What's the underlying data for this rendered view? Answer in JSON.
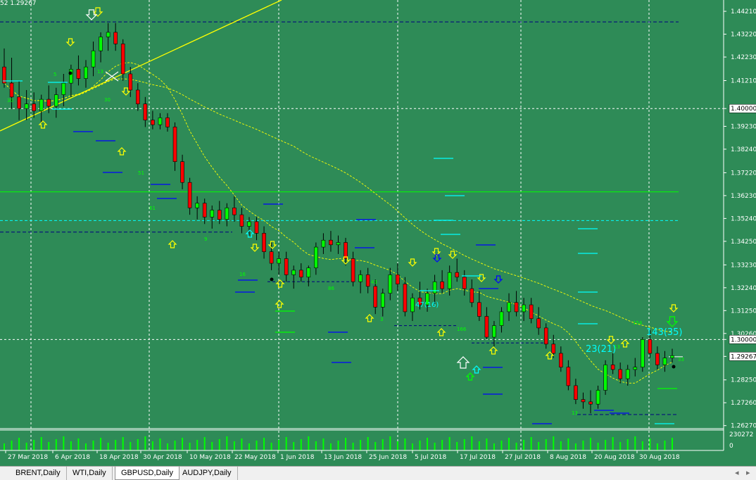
{
  "window": {
    "corner_text": "52 1.29267"
  },
  "price_axis": {
    "labels": [
      "1.44210",
      "1.43220",
      "1.42230",
      "1.41210",
      "1.40000",
      "1.39230",
      "1.38240",
      "1.37220",
      "1.36230",
      "1.35240",
      "1.34250",
      "1.33230",
      "1.32240",
      "1.31250",
      "1.30260",
      "1.30000",
      "1.29267",
      "1.28250",
      "1.27260",
      "1.26270"
    ],
    "highlight_labels": {
      "level_1": "1.40000",
      "level_2": "1.30000",
      "current": "1.29267"
    }
  },
  "volume_axis": {
    "labels": [
      "230272",
      "0"
    ]
  },
  "date_axis": {
    "labels": [
      "27 Mar 2018",
      "6 Apr 2018",
      "18 Apr 2018",
      "30 Apr 2018",
      "10 May 2018",
      "22 May 2018",
      "1 Jun 2018",
      "13 Jun 2018",
      "25 Jun 2018",
      "5 Jul 2018",
      "17 Jul 2018",
      "27 Jul 2018",
      "8 Aug 2018",
      "20 Aug 2018",
      "30 Aug 2018"
    ]
  },
  "annotations": {
    "count_1": "47(16)",
    "count_2": "23(21)",
    "count_3": "143(35)",
    "small_numbers": [
      "30",
      "5",
      "13",
      "30",
      "51",
      "61",
      "9",
      "16",
      "86",
      "43",
      "3",
      "166",
      "154",
      "13",
      "13",
      "33"
    ]
  },
  "tabs": {
    "items": [
      {
        "label": "BRENT,Daily"
      },
      {
        "label": "WTI,Daily"
      },
      {
        "label": "GBPUSD,Daily"
      },
      {
        "label": "AUDJPY,Daily"
      }
    ],
    "active": "GBPUSD,Daily",
    "nav_left": "◂",
    "nav_right": "▸"
  },
  "colors": {
    "background": "#2e8b57",
    "bull_candle": "#00ff00",
    "bear_candle": "#ff0000",
    "trend_line": "#ffff00",
    "horizontal_green": "#00ff00",
    "horizontal_cyan": "#00ffff",
    "dashed_navy": "#000080",
    "grid": "#ffffff"
  },
  "chart_data": {
    "type": "candlestick",
    "symbol": "GBPUSD",
    "timeframe": "Daily",
    "ylim": [
      1.262,
      1.447
    ],
    "current_price": 1.29267,
    "ohlc": [
      [
        1.418,
        1.426,
        1.409,
        1.411
      ],
      [
        1.411,
        1.422,
        1.4,
        1.405
      ],
      [
        1.405,
        1.412,
        1.395,
        1.4
      ],
      [
        1.4,
        1.408,
        1.395,
        1.402
      ],
      [
        1.402,
        1.407,
        1.396,
        1.399
      ],
      [
        1.399,
        1.406,
        1.394,
        1.404
      ],
      [
        1.404,
        1.41,
        1.398,
        1.401
      ],
      [
        1.401,
        1.409,
        1.396,
        1.406
      ],
      [
        1.406,
        1.415,
        1.401,
        1.411
      ],
      [
        1.411,
        1.419,
        1.405,
        1.417
      ],
      [
        1.417,
        1.423,
        1.41,
        1.413
      ],
      [
        1.413,
        1.421,
        1.409,
        1.418
      ],
      [
        1.418,
        1.429,
        1.414,
        1.425
      ],
      [
        1.425,
        1.433,
        1.42,
        1.431
      ],
      [
        1.431,
        1.437,
        1.425,
        1.433
      ],
      [
        1.433,
        1.437,
        1.425,
        1.428
      ],
      [
        1.428,
        1.43,
        1.412,
        1.415
      ],
      [
        1.415,
        1.418,
        1.405,
        1.408
      ],
      [
        1.408,
        1.411,
        1.399,
        1.402
      ],
      [
        1.402,
        1.405,
        1.392,
        1.395
      ],
      [
        1.395,
        1.399,
        1.391,
        1.393
      ],
      [
        1.393,
        1.398,
        1.391,
        1.396
      ],
      [
        1.396,
        1.398,
        1.39,
        1.392
      ],
      [
        1.392,
        1.394,
        1.373,
        1.377
      ],
      [
        1.377,
        1.38,
        1.365,
        1.368
      ],
      [
        1.368,
        1.37,
        1.354,
        1.357
      ],
      [
        1.357,
        1.362,
        1.352,
        1.359
      ],
      [
        1.359,
        1.361,
        1.35,
        1.353
      ],
      [
        1.353,
        1.358,
        1.348,
        1.356
      ],
      [
        1.356,
        1.36,
        1.35,
        1.352
      ],
      [
        1.352,
        1.359,
        1.349,
        1.357
      ],
      [
        1.357,
        1.362,
        1.351,
        1.354
      ],
      [
        1.354,
        1.357,
        1.346,
        1.349
      ],
      [
        1.349,
        1.353,
        1.345,
        1.351
      ],
      [
        1.351,
        1.353,
        1.343,
        1.346
      ],
      [
        1.346,
        1.349,
        1.335,
        1.338
      ],
      [
        1.338,
        1.342,
        1.33,
        1.333
      ],
      [
        1.333,
        1.338,
        1.328,
        1.335
      ],
      [
        1.335,
        1.338,
        1.325,
        1.328
      ],
      [
        1.328,
        1.332,
        1.322,
        1.33
      ],
      [
        1.33,
        1.333,
        1.325,
        1.327
      ],
      [
        1.327,
        1.332,
        1.323,
        1.331
      ],
      [
        1.331,
        1.342,
        1.328,
        1.34
      ],
      [
        1.34,
        1.346,
        1.337,
        1.343
      ],
      [
        1.343,
        1.347,
        1.338,
        1.341
      ],
      [
        1.341,
        1.345,
        1.337,
        1.342
      ],
      [
        1.342,
        1.344,
        1.332,
        1.335
      ],
      [
        1.335,
        1.338,
        1.323,
        1.325
      ],
      [
        1.325,
        1.33,
        1.32,
        1.328
      ],
      [
        1.328,
        1.331,
        1.32,
        1.323
      ],
      [
        1.323,
        1.326,
        1.311,
        1.314
      ],
      [
        1.314,
        1.322,
        1.31,
        1.32
      ],
      [
        1.32,
        1.331,
        1.317,
        1.328
      ],
      [
        1.328,
        1.333,
        1.321,
        1.324
      ],
      [
        1.324,
        1.327,
        1.31,
        1.312
      ],
      [
        1.312,
        1.32,
        1.308,
        1.318
      ],
      [
        1.318,
        1.325,
        1.313,
        1.315
      ],
      [
        1.315,
        1.322,
        1.312,
        1.32
      ],
      [
        1.32,
        1.328,
        1.315,
        1.325
      ],
      [
        1.325,
        1.33,
        1.32,
        1.322
      ],
      [
        1.322,
        1.332,
        1.319,
        1.329
      ],
      [
        1.329,
        1.335,
        1.325,
        1.327
      ],
      [
        1.327,
        1.33,
        1.319,
        1.322
      ],
      [
        1.322,
        1.326,
        1.314,
        1.316
      ],
      [
        1.316,
        1.321,
        1.308,
        1.31
      ],
      [
        1.31,
        1.314,
        1.3,
        1.301
      ],
      [
        1.301,
        1.308,
        1.297,
        1.306
      ],
      [
        1.306,
        1.314,
        1.303,
        1.312
      ],
      [
        1.312,
        1.32,
        1.308,
        1.316
      ],
      [
        1.316,
        1.321,
        1.31,
        1.312
      ],
      [
        1.312,
        1.318,
        1.308,
        1.315
      ],
      [
        1.315,
        1.318,
        1.307,
        1.309
      ],
      [
        1.309,
        1.314,
        1.302,
        1.305
      ],
      [
        1.305,
        1.307,
        1.296,
        1.298
      ],
      [
        1.298,
        1.302,
        1.292,
        1.294
      ],
      [
        1.294,
        1.297,
        1.286,
        1.288
      ],
      [
        1.288,
        1.291,
        1.278,
        1.28
      ],
      [
        1.28,
        1.283,
        1.272,
        1.274
      ],
      [
        1.274,
        1.277,
        1.27,
        1.273
      ],
      [
        1.273,
        1.278,
        1.268,
        1.272
      ],
      [
        1.272,
        1.28,
        1.27,
        1.278
      ],
      [
        1.278,
        1.291,
        1.276,
        1.289
      ],
      [
        1.289,
        1.294,
        1.285,
        1.287
      ],
      [
        1.287,
        1.29,
        1.281,
        1.283
      ],
      [
        1.283,
        1.289,
        1.28,
        1.287
      ],
      [
        1.287,
        1.292,
        1.284,
        1.288
      ],
      [
        1.288,
        1.301,
        1.286,
        1.3
      ],
      [
        1.3,
        1.304,
        1.292,
        1.294
      ],
      [
        1.294,
        1.297,
        1.287,
        1.289
      ],
      [
        1.289,
        1.295,
        1.286,
        1.292
      ],
      [
        1.292,
        1.296,
        1.29,
        1.293
      ]
    ]
  }
}
